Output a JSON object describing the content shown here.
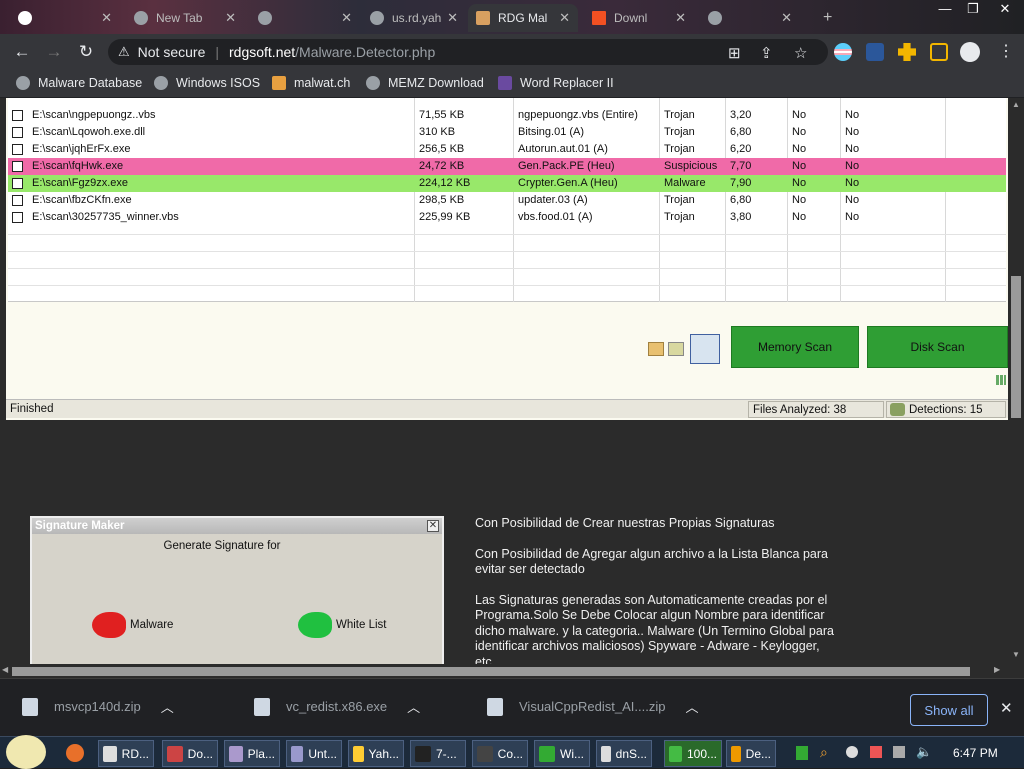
{
  "browser": {
    "tabs": [
      {
        "label": "",
        "active": false
      },
      {
        "label": "New Tab",
        "active": false
      },
      {
        "label": "",
        "active": false
      },
      {
        "label": "us.rd.yah",
        "active": false
      },
      {
        "label": "RDG Mal",
        "active": true
      },
      {
        "label": "Downl",
        "active": false
      },
      {
        "label": "",
        "active": false
      }
    ],
    "security_label": "Not secure",
    "url_host": "rdgsoft.net",
    "url_path": "/Malware.Detector.php",
    "bookmarks": [
      "Malware Database",
      "Windows ISOS",
      "malwat.ch",
      "MEMZ Download",
      "Word Replacer II"
    ]
  },
  "scan_table": {
    "rows": [
      {
        "path": "E:\\scan\\ngpepuongz..vbs",
        "size": "71,55 KB",
        "detection": "ngpepuongz.vbs (Entire)",
        "type": "Trojan",
        "score": "3,20",
        "c1": "No",
        "c2": "No",
        "highlight": ""
      },
      {
        "path": "E:\\scan\\Lqowoh.exe.dll",
        "size": "310 KB",
        "detection": "Bitsing.01 (A)",
        "type": "Trojan",
        "score": "6,80",
        "c1": "No",
        "c2": "No",
        "highlight": ""
      },
      {
        "path": "E:\\scan\\jqhErFx.exe",
        "size": "256,5 KB",
        "detection": "Autorun.aut.01 (A)",
        "type": "Trojan",
        "score": "6,20",
        "c1": "No",
        "c2": "No",
        "highlight": ""
      },
      {
        "path": "E:\\scan\\fqHwk.exe",
        "size": "24,72 KB",
        "detection": "Gen.Pack.PE (Heu)",
        "type": "Suspicious",
        "score": "7,70",
        "c1": "No",
        "c2": "No",
        "highlight": "pink"
      },
      {
        "path": "E:\\scan\\Fgz9zx.exe",
        "size": "224,12 KB",
        "detection": "Crypter.Gen.A (Heu)",
        "type": "Malware",
        "score": "7,90",
        "c1": "No",
        "c2": "No",
        "highlight": "green"
      },
      {
        "path": "E:\\scan\\fbzCKfn.exe",
        "size": "298,5 KB",
        "detection": "updater.03 (A)",
        "type": "Trojan",
        "score": "6,80",
        "c1": "No",
        "c2": "No",
        "highlight": ""
      },
      {
        "path": "E:\\scan\\30257735_winner.vbs",
        "size": "225,99 KB",
        "detection": "vbs.food.01 (A)",
        "type": "Trojan",
        "score": "3,80",
        "c1": "No",
        "c2": "No",
        "highlight": ""
      }
    ]
  },
  "buttons": {
    "memory_scan": "Memory Scan",
    "disk_scan": "Disk Scan"
  },
  "status": {
    "state": "Finished",
    "files_analyzed": "Files Analyzed: 38",
    "detections": "Detections: 15"
  },
  "signature_maker": {
    "title": "Signature Maker",
    "prompt": "Generate Signature for",
    "malware_label": "Malware",
    "whitelist_label": "White List"
  },
  "description": [
    "Con Posibilidad de Crear nuestras Propias Signaturas",
    "Con Posibilidad de Agregar algun archivo a la Lista Blanca para evitar ser detectado",
    "Las Signaturas generadas son Automaticamente creadas por el Programa.Solo Se Debe Colocar algun Nombre para identificar dicho malware. y la categoria.. Malware (Un Termino Global para identificar archivos maliciosos) Spyware - Adware - Keylogger, etc"
  ],
  "downloads": {
    "items": [
      "msvcp140d.zip",
      "vc_redist.x86.exe",
      "VisualCppRedist_AI....zip"
    ],
    "show_all": "Show all"
  },
  "taskbar": {
    "items": [
      "RD...",
      "Do...",
      "Pla...",
      "Unt...",
      "Yah...",
      "7-...",
      "Co...",
      "Wi...",
      "dnS...",
      "100...",
      "De..."
    ],
    "clock": "6:47 PM"
  },
  "colors": {
    "pink_row": "#f06aa8",
    "green_row": "#98e86a",
    "scan_button": "#2f9e34"
  }
}
